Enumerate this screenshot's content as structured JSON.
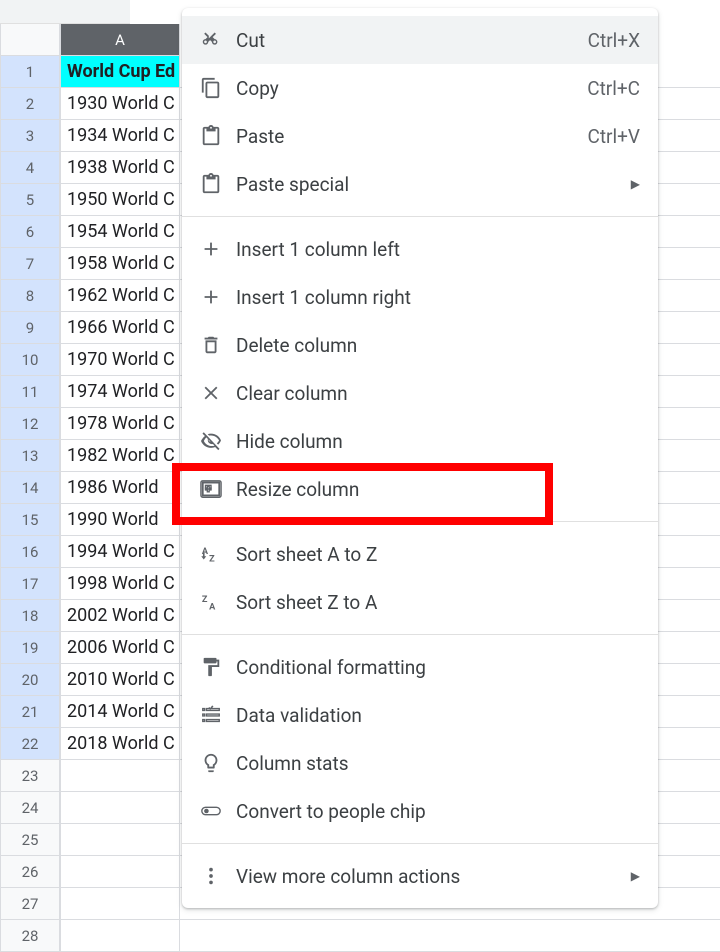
{
  "column_header": "A",
  "header_cell": "World Cup Ed",
  "rows": [
    "1930 World C",
    "1934 World C",
    "1938 World C",
    "1950 World C",
    "1954 World C",
    "1958 World C",
    "1962 World C",
    "1966 World C",
    "1970 World C",
    "1974 World C",
    "1978 World C",
    "1982 World C",
    "1986 World ",
    "1990 World ",
    "1994 World C",
    "1998 World C",
    "2002 World C",
    "2006 World C",
    "2010 World C",
    "2014 World C",
    "2018 World C"
  ],
  "row_numbers": [
    1,
    2,
    3,
    4,
    5,
    6,
    7,
    8,
    9,
    10,
    11,
    12,
    13,
    14,
    15,
    16,
    17,
    18,
    19,
    20,
    21,
    22,
    23,
    24,
    25,
    26,
    27,
    28
  ],
  "menu": {
    "cut": "Cut",
    "cut_sc": "Ctrl+X",
    "copy": "Copy",
    "copy_sc": "Ctrl+C",
    "paste": "Paste",
    "paste_sc": "Ctrl+V",
    "paste_special": "Paste special",
    "insert_left": "Insert 1 column left",
    "insert_right": "Insert 1 column right",
    "delete_col": "Delete column",
    "clear_col": "Clear column",
    "hide_col": "Hide column",
    "resize_col": "Resize column",
    "sort_az": "Sort sheet A to Z",
    "sort_za": "Sort sheet Z to A",
    "cond_fmt": "Conditional formatting",
    "data_val": "Data validation",
    "col_stats": "Column stats",
    "convert_people": "Convert to people chip",
    "more_actions": "View more column actions"
  }
}
